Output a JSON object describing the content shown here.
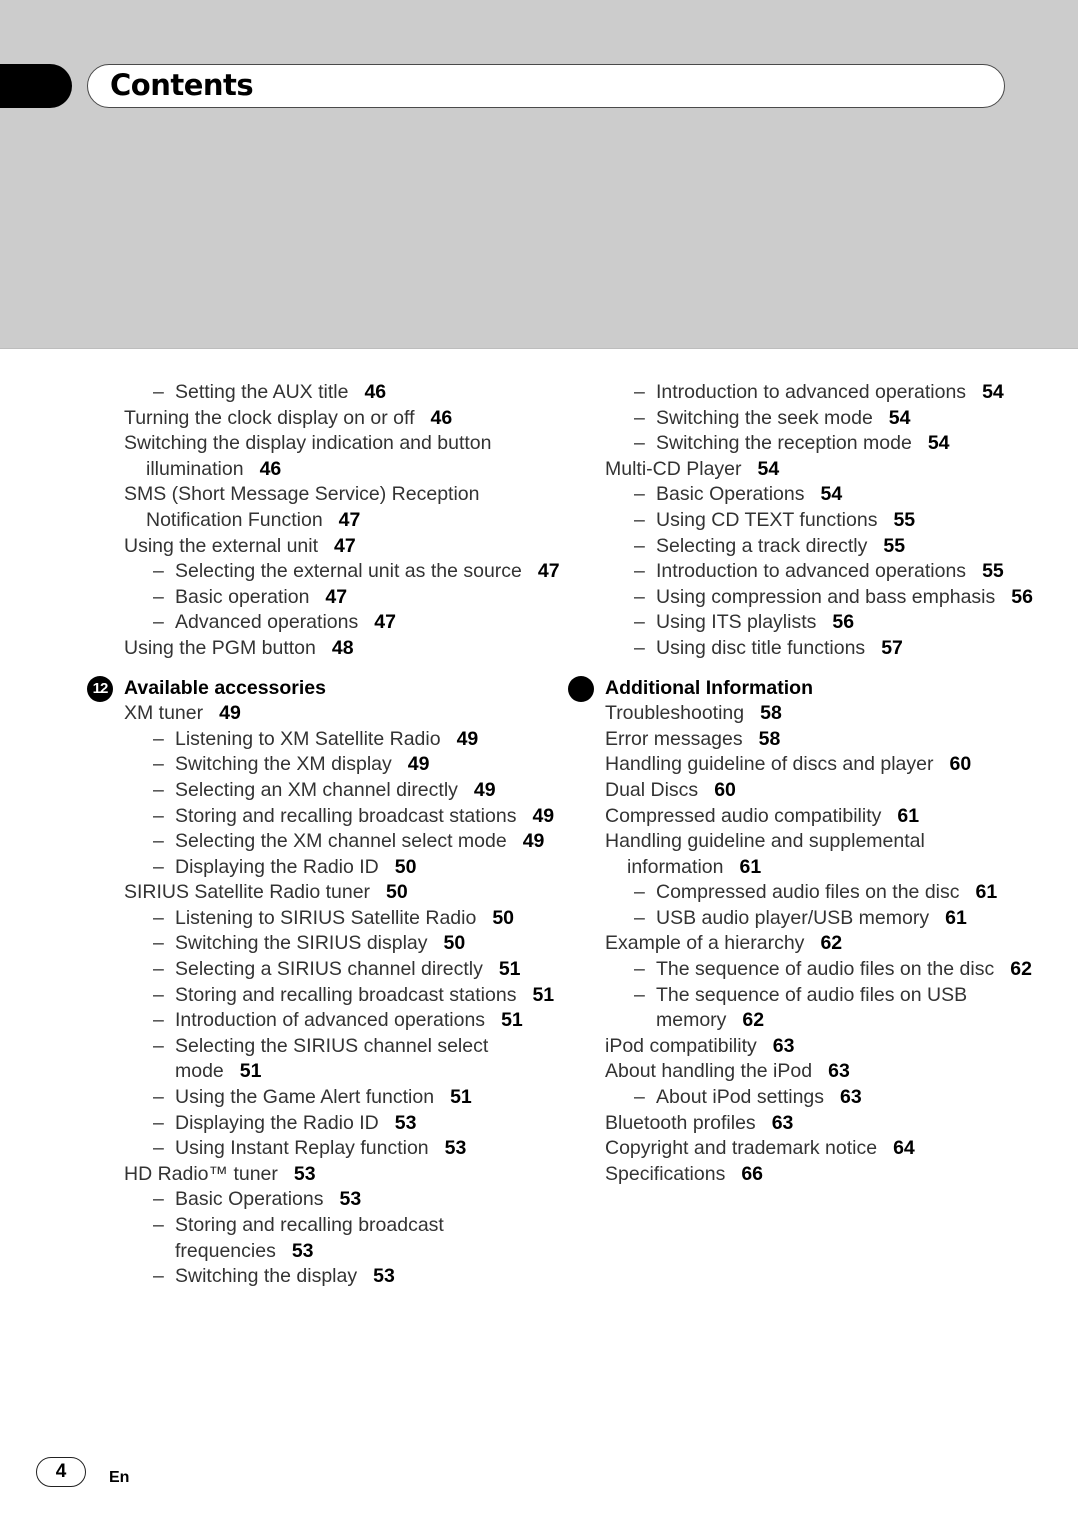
{
  "header": {
    "title": "Contents"
  },
  "left_column": [
    {
      "type": "entry",
      "level": 2,
      "text": "Setting the AUX title",
      "page": "46"
    },
    {
      "type": "entry",
      "level": 1,
      "text": "Turning the clock display on or off",
      "page": "46"
    },
    {
      "type": "entry",
      "level": 1,
      "text": "Switching the display indication and button illumination",
      "page": "46"
    },
    {
      "type": "entry",
      "level": 1,
      "text": "SMS (Short Message Service) Reception Notification Function",
      "page": "47"
    },
    {
      "type": "entry",
      "level": 1,
      "text": "Using the external unit",
      "page": "47"
    },
    {
      "type": "entry",
      "level": 2,
      "text": "Selecting the external unit as the source",
      "page": "47"
    },
    {
      "type": "entry",
      "level": 2,
      "text": "Basic operation",
      "page": "47"
    },
    {
      "type": "entry",
      "level": 2,
      "text": "Advanced operations",
      "page": "47"
    },
    {
      "type": "entry",
      "level": 1,
      "text": "Using the PGM button",
      "page": "48"
    },
    {
      "type": "section",
      "badge": "12",
      "text": "Available accessories"
    },
    {
      "type": "entry",
      "level": 1,
      "text": "XM tuner",
      "page": "49"
    },
    {
      "type": "entry",
      "level": 2,
      "text": "Listening to XM Satellite Radio",
      "page": "49"
    },
    {
      "type": "entry",
      "level": 2,
      "text": "Switching the XM display",
      "page": "49"
    },
    {
      "type": "entry",
      "level": 2,
      "text": "Selecting an XM channel directly",
      "page": "49"
    },
    {
      "type": "entry",
      "level": 2,
      "text": "Storing and recalling broadcast stations",
      "page": "49"
    },
    {
      "type": "entry",
      "level": 2,
      "text": "Selecting the XM channel select mode",
      "page": "49"
    },
    {
      "type": "entry",
      "level": 2,
      "text": "Displaying the Radio ID",
      "page": "50"
    },
    {
      "type": "entry",
      "level": 1,
      "text": "SIRIUS Satellite Radio tuner",
      "page": "50"
    },
    {
      "type": "entry",
      "level": 2,
      "text": "Listening to SIRIUS Satellite Radio",
      "page": "50"
    },
    {
      "type": "entry",
      "level": 2,
      "text": "Switching the SIRIUS display",
      "page": "50"
    },
    {
      "type": "entry",
      "level": 2,
      "text": "Selecting a SIRIUS channel directly",
      "page": "51"
    },
    {
      "type": "entry",
      "level": 2,
      "text": "Storing and recalling broadcast stations",
      "page": "51"
    },
    {
      "type": "entry",
      "level": 2,
      "text": "Introduction of advanced operations",
      "page": "51"
    },
    {
      "type": "entry",
      "level": 2,
      "text": "Selecting the SIRIUS channel select mode",
      "page": "51"
    },
    {
      "type": "entry",
      "level": 2,
      "text": "Using the Game Alert function",
      "page": "51"
    },
    {
      "type": "entry",
      "level": 2,
      "text": "Displaying the Radio ID",
      "page": "53"
    },
    {
      "type": "entry",
      "level": 2,
      "text": "Using Instant Replay function",
      "page": "53"
    },
    {
      "type": "entry",
      "level": 1,
      "text": "HD Radio™ tuner",
      "page": "53"
    },
    {
      "type": "entry",
      "level": 2,
      "text": "Basic Operations",
      "page": "53"
    },
    {
      "type": "entry",
      "level": 2,
      "text": "Storing and recalling broadcast frequencies",
      "page": "53"
    },
    {
      "type": "entry",
      "level": 2,
      "text": "Switching the display",
      "page": "53"
    }
  ],
  "right_column": [
    {
      "type": "entry",
      "level": 2,
      "text": "Introduction to advanced operations",
      "page": "54"
    },
    {
      "type": "entry",
      "level": 2,
      "text": "Switching the seek mode",
      "page": "54"
    },
    {
      "type": "entry",
      "level": 2,
      "text": "Switching the reception mode",
      "page": "54"
    },
    {
      "type": "entry",
      "level": 1,
      "text": "Multi-CD Player",
      "page": "54"
    },
    {
      "type": "entry",
      "level": 2,
      "text": "Basic Operations",
      "page": "54"
    },
    {
      "type": "entry",
      "level": 2,
      "text": "Using CD TEXT functions",
      "page": "55"
    },
    {
      "type": "entry",
      "level": 2,
      "text": "Selecting a track directly",
      "page": "55"
    },
    {
      "type": "entry",
      "level": 2,
      "text": "Introduction to advanced operations",
      "page": "55"
    },
    {
      "type": "entry",
      "level": 2,
      "text": "Using compression and bass emphasis",
      "page": "56"
    },
    {
      "type": "entry",
      "level": 2,
      "text": "Using ITS playlists",
      "page": "56"
    },
    {
      "type": "entry",
      "level": 2,
      "text": "Using disc title functions",
      "page": "57"
    },
    {
      "type": "section",
      "badge": "",
      "text": "Additional Information"
    },
    {
      "type": "entry",
      "level": 1,
      "text": "Troubleshooting",
      "page": "58"
    },
    {
      "type": "entry",
      "level": 1,
      "text": "Error messages",
      "page": "58"
    },
    {
      "type": "entry",
      "level": 1,
      "text": "Handling guideline of discs and player",
      "page": "60"
    },
    {
      "type": "entry",
      "level": 1,
      "text": "Dual Discs",
      "page": "60"
    },
    {
      "type": "entry",
      "level": 1,
      "text": "Compressed audio compatibility",
      "page": "61"
    },
    {
      "type": "entry",
      "level": 1,
      "text": "Handling guideline and supplemental information",
      "page": "61"
    },
    {
      "type": "entry",
      "level": 2,
      "text": "Compressed audio files on the disc",
      "page": "61"
    },
    {
      "type": "entry",
      "level": 2,
      "text": "USB audio player/USB memory",
      "page": "61"
    },
    {
      "type": "entry",
      "level": 1,
      "text": "Example of a hierarchy",
      "page": "62"
    },
    {
      "type": "entry",
      "level": 2,
      "text": "The sequence of audio files on the disc",
      "page": "62"
    },
    {
      "type": "entry",
      "level": 2,
      "text": "The sequence of audio files on USB memory",
      "page": "62"
    },
    {
      "type": "entry",
      "level": 1,
      "text": "iPod compatibility",
      "page": "63"
    },
    {
      "type": "entry",
      "level": 1,
      "text": "About handling the iPod",
      "page": "63"
    },
    {
      "type": "entry",
      "level": 2,
      "text": "About iPod settings",
      "page": "63"
    },
    {
      "type": "entry",
      "level": 1,
      "text": "Bluetooth profiles",
      "page": "63"
    },
    {
      "type": "entry",
      "level": 1,
      "text": "Copyright and trademark notice",
      "page": "64"
    },
    {
      "type": "entry",
      "level": 1,
      "text": "Specifications",
      "page": "66"
    }
  ],
  "footer": {
    "page_number": "4",
    "language": "En"
  },
  "icons": {
    "dash": "–"
  }
}
